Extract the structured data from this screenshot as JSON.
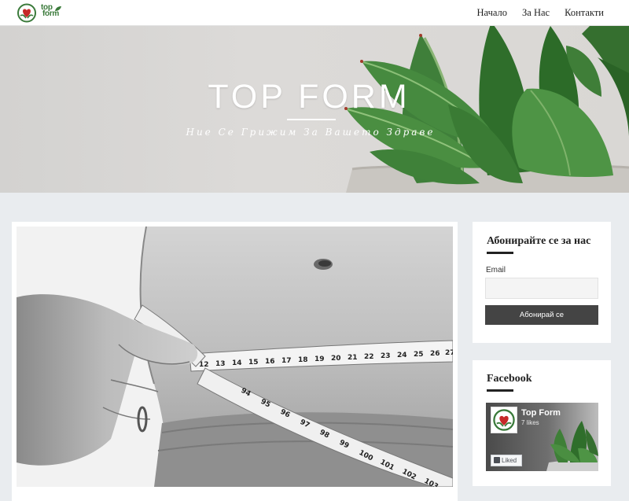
{
  "header": {
    "logo_line1": "top",
    "logo_line2": "form",
    "nav": [
      {
        "label": "Начало"
      },
      {
        "label": "За Нас"
      },
      {
        "label": "Контакти"
      }
    ]
  },
  "hero": {
    "title": "TOP FORM",
    "subtitle": "Ние Се Грижим За Вашето Здраве"
  },
  "subscribe": {
    "title": "Абонирайте се за нас",
    "email_label": "Email",
    "email_value": "",
    "button_label": "Абонирай се"
  },
  "facebook": {
    "title": "Facebook",
    "page_name": "Top Form",
    "likes": "7 likes",
    "liked_label": "Liked"
  },
  "colors": {
    "brand_green": "#3a7a3a",
    "brand_red": "#c62828",
    "button_dark": "#444444",
    "page_bg": "#e9ecef"
  }
}
